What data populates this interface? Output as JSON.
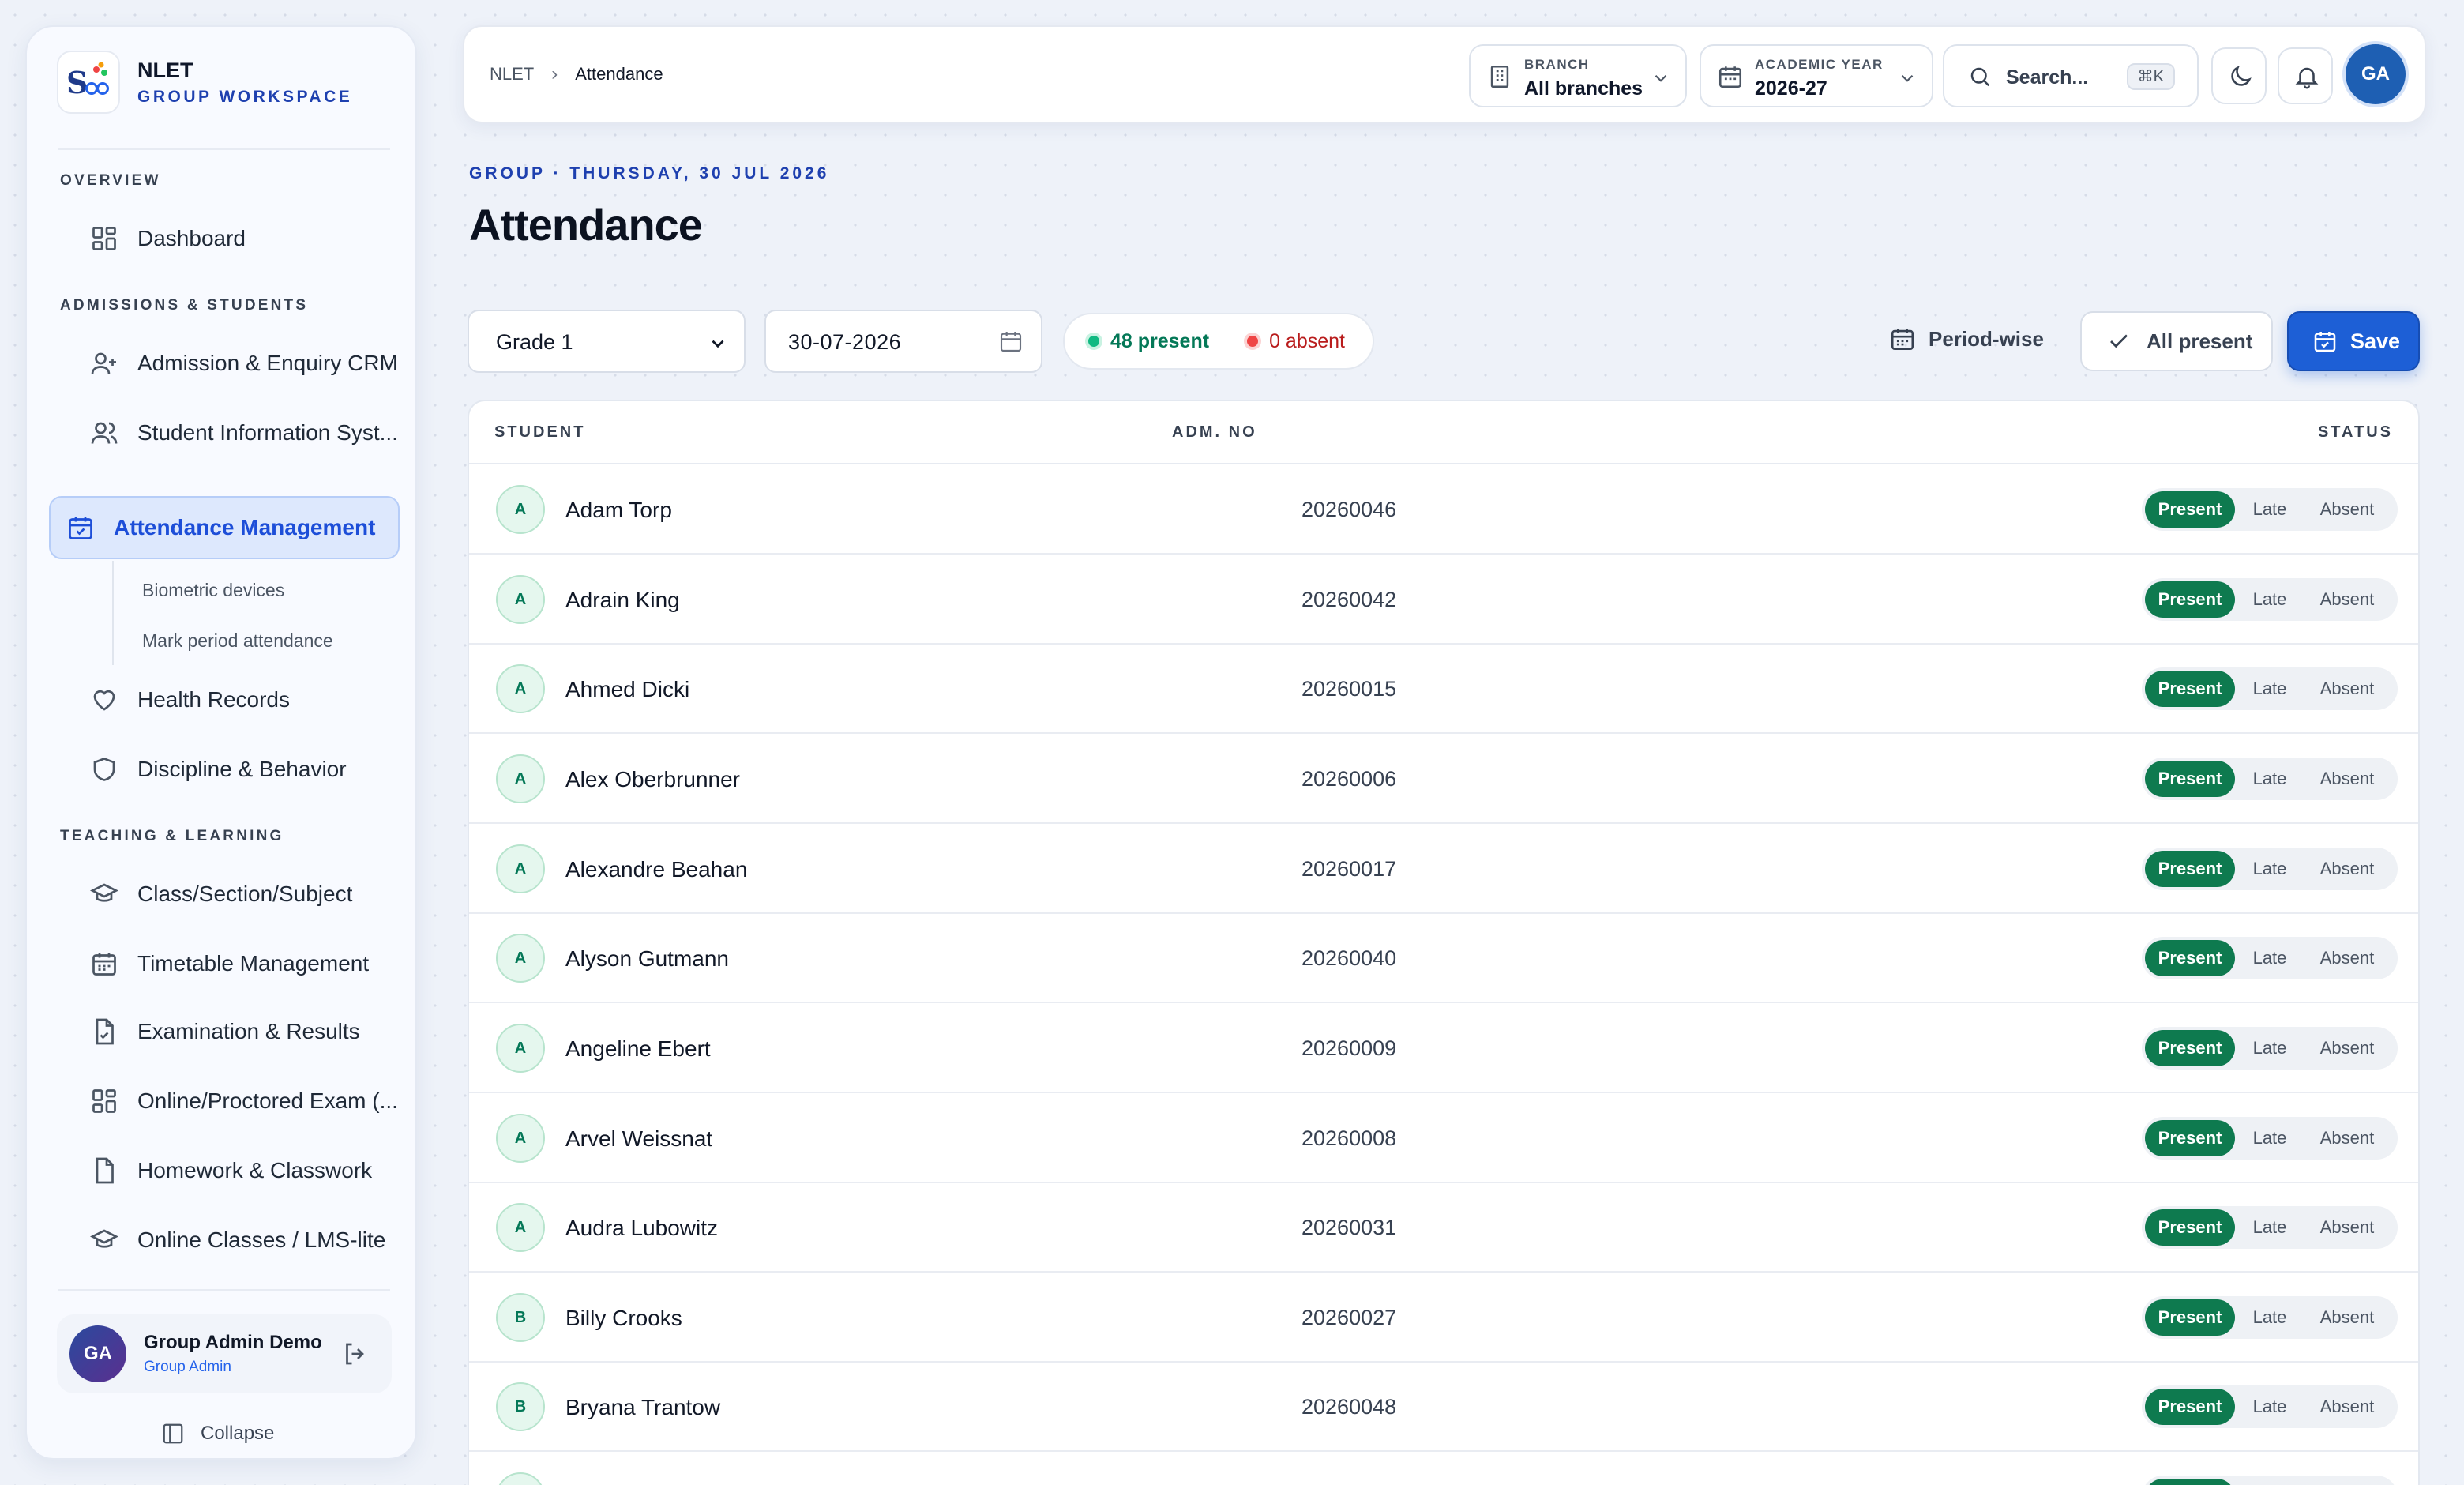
{
  "brand": {
    "logo_text": "Sਠ",
    "name": "NLET",
    "subtitle": "GROUP WORKSPACE"
  },
  "sidebar": {
    "sections": [
      {
        "title": "OVERVIEW"
      },
      {
        "title": "ADMISSIONS & STUDENTS"
      },
      {
        "title": "TEACHING & LEARNING"
      }
    ],
    "items": [
      {
        "label": "Dashboard",
        "icon": "grid-icon"
      },
      {
        "label": "Admission & Enquiry CRM",
        "icon": "user-plus-icon"
      },
      {
        "label": "Student Information Syst...",
        "icon": "users-icon"
      },
      {
        "label": "Attendance Management",
        "icon": "calendar-check-icon",
        "active": true
      },
      {
        "label": "Health Records",
        "icon": "heart-icon"
      },
      {
        "label": "Discipline & Behavior",
        "icon": "shield-icon"
      },
      {
        "label": "Class/Section/Subject",
        "icon": "graduation-cap-icon"
      },
      {
        "label": "Timetable Management",
        "icon": "calendar-icon"
      },
      {
        "label": "Examination & Results",
        "icon": "file-check-icon"
      },
      {
        "label": "Online/Proctored Exam (...",
        "icon": "grid-icon"
      },
      {
        "label": "Homework & Classwork",
        "icon": "file-icon"
      },
      {
        "label": "Online Classes / LMS-lite",
        "icon": "graduation-cap-icon"
      }
    ],
    "subitems": [
      {
        "label": "Biometric devices"
      },
      {
        "label": "Mark period attendance"
      }
    ],
    "user": {
      "initials": "GA",
      "name": "Group Admin Demo",
      "role": "Group Admin"
    },
    "collapse_label": "Collapse"
  },
  "topbar": {
    "breadcrumb": [
      "NLET",
      "Attendance"
    ],
    "branch": {
      "caption": "BRANCH",
      "value": "All branches"
    },
    "year": {
      "caption": "ACADEMIC YEAR",
      "value": "2026-27"
    },
    "search": {
      "placeholder": "Search...",
      "shortcut": "⌘K"
    },
    "avatar": "GA"
  },
  "header": {
    "eyebrow": "GROUP · THURSDAY, 30 JUL 2026",
    "title": "Attendance"
  },
  "filters": {
    "grade": "Grade 1",
    "date": "30-07-2026",
    "present_summary": "48 present",
    "absent_summary": "0 absent",
    "period_label": "Period-wise",
    "all_present_label": "All present",
    "save_label": "Save"
  },
  "table": {
    "columns": {
      "student": "STUDENT",
      "adm": "ADM. NO",
      "status": "STATUS"
    },
    "status_options": {
      "present": "Present",
      "late": "Late",
      "absent": "Absent"
    },
    "rows": [
      {
        "initial": "A",
        "name": "Adam Torp",
        "adm": "20260046",
        "status": "Present"
      },
      {
        "initial": "A",
        "name": "Adrain King",
        "adm": "20260042",
        "status": "Present"
      },
      {
        "initial": "A",
        "name": "Ahmed Dicki",
        "adm": "20260015",
        "status": "Present"
      },
      {
        "initial": "A",
        "name": "Alex Oberbrunner",
        "adm": "20260006",
        "status": "Present"
      },
      {
        "initial": "A",
        "name": "Alexandre Beahan",
        "adm": "20260017",
        "status": "Present"
      },
      {
        "initial": "A",
        "name": "Alyson Gutmann",
        "adm": "20260040",
        "status": "Present"
      },
      {
        "initial": "A",
        "name": "Angeline Ebert",
        "adm": "20260009",
        "status": "Present"
      },
      {
        "initial": "A",
        "name": "Arvel Weissnat",
        "adm": "20260008",
        "status": "Present"
      },
      {
        "initial": "A",
        "name": "Audra Lubowitz",
        "adm": "20260031",
        "status": "Present"
      },
      {
        "initial": "B",
        "name": "Billy Crooks",
        "adm": "20260027",
        "status": "Present"
      },
      {
        "initial": "B",
        "name": "Bryana Trantow",
        "adm": "20260048",
        "status": "Present"
      }
    ]
  },
  "colors": {
    "accent": "#1d5fd6",
    "present": "#0e7a4f",
    "absent": "#b91c1c"
  }
}
